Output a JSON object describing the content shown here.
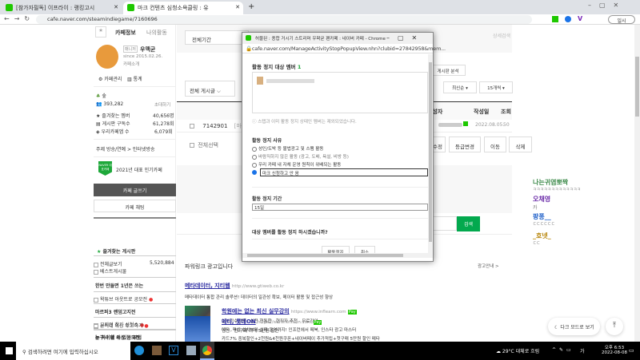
{
  "browser": {
    "tabs": [
      {
        "label": "[참가자필독] 이프라이 : 랭킹고시"
      },
      {
        "label": "마크 컨텐츠 심청소욕클링 : 유"
      }
    ],
    "url": "cafe.naver.com/steamindiegame/7160696",
    "profile_label": "일시"
  },
  "sidebar": {
    "tab_info": "카페정보",
    "tab_activity": "나의활동",
    "manager_badge": "매니저",
    "manager_name": "우맥균",
    "since": "since 2015.02.26.",
    "intro": "카페소개",
    "manage": "카페관리",
    "stats": "통계",
    "level": "숲",
    "members": "393,282",
    "invite": "초대하기",
    "stats_rows": [
      {
        "label": "즐겨찾는 멤버",
        "value": "40,656명"
      },
      {
        "label": "게시판 구독수",
        "value": "61,278회"
      },
      {
        "label": "우리카페앱 수",
        "value": "6,079회"
      }
    ],
    "topic": "주제 방송/연예 > 인터넷방송",
    "award_badge": "NAVER 대표카페",
    "award": "2021년 대표 인기카페",
    "write_btn": "카페 글쓰기",
    "chat_btn": "카페 채팅",
    "fav_header": "즐겨찾는 게시판",
    "boards": [
      {
        "type": "item",
        "label": "전체글보기",
        "count": "5,520,884"
      },
      {
        "type": "item",
        "label": "베스트게시물"
      },
      {
        "type": "header",
        "label": "한번 만들면 1년은 쓰는"
      },
      {
        "type": "item",
        "label": "왁튜브 아웃트로 공모전",
        "new": true
      },
      {
        "type": "header",
        "label": "마르퍼3 랜덤고지전"
      },
      {
        "type": "item",
        "label": "고지전 참가 신청소",
        "new": true
      },
      {
        "type": "header",
        "label": "늗 하이네 의상 공모전"
      },
      {
        "type": "item",
        "label": "늗이네 의상 투고하기",
        "new": true
      },
      {
        "type": "header",
        "label": "누구나 할 수 있는 부업"
      }
    ]
  },
  "main": {
    "period": "전체기간",
    "search_btn": "검색",
    "detail_search": "상세검색",
    "board_filter": "전체 게시글",
    "analysis_btn": "게시판 분석",
    "sort": "최신순",
    "per_page": "15개씩",
    "columns": [
      "작성자",
      "작성일",
      "조회"
    ],
    "row": {
      "id": "7142901",
      "prefix": "[마",
      "date": "2022.08.05.",
      "views": "50"
    },
    "select_all": "전체선택",
    "actions": [
      "머리 수정",
      "등급변경",
      "이동",
      "삭제"
    ],
    "search_btn2": "검색",
    "ad_header": "파워링크 광고입니다",
    "ad_info": "광고안내 >",
    "ads": [
      {
        "title": "메타데이터, 지티웹",
        "url": "http://www.gtiweb.co.kr",
        "desc": "메타데이터 통합 관리 솔루션! 데이터의 일관성 확보, 메이터 활용 및 접근성 향상"
      },
      {
        "title": "학원에는 없는 최신 실무강의",
        "url": "https://www.inflearn.com",
        "pay": "Pay",
        "sub": "실시간수강평 · 실전 현통합 · 현직자 추천 · 무료강의",
        "desc": "메타, 픽셀 설치부터 실제 운영까지! 인프런에서 페북, 인스타 광고 마스터"
      },
      {
        "title": "메타, 롯데ON",
        "url": "https://www.lotteon.com",
        "pay": "Pay",
        "sub": "멤인 · 전 구매 최대 5만원 할인",
        "desc": "카드7% 중복할인+2천원&4천원쿠폰+네이버페이 추가적립+첫구매 5만원 할인 메타"
      }
    ]
  },
  "popup": {
    "title": "허물된 : 종합 거시기 스트리머 우왁굳 팬카페 : 네이버 카페 - Chrome",
    "url": "cafe.naver.com/ManageActivityStopPopupView.nhn?clubid=27842958&mem...",
    "target_label": "활동 정지 대상 멤버",
    "target_count": "1",
    "notice": "스탭과 이미 활동 정지 상태인 멤버는 제외되었습니다.",
    "reason_label": "활동 정지 사유",
    "reasons": [
      "성인/도박 등 불법광고 및 스팸 활동",
      "바람직하지 않은 활동 (광고, 도배, 욕설, 비방 등)",
      "우리 카페 내 자체 운영 원칙이 위배되는 활동"
    ],
    "custom_reason": "마크 신청하고 안 옴",
    "period_label": "활동 정지 기간",
    "period_value": "15일",
    "confirm_q": "대상 멤버를 활동 정지 하시겠습니까?",
    "ok": "활동정지",
    "cancel": "취소"
  },
  "chat": [
    {
      "name": "나는귀염뽀짝",
      "msg": "ㅋㅋㅋㅋㅋㅋㅋㅋㅋㅋㅋㅋㅋ",
      "color": "#3d8a4a"
    },
    {
      "name": "오채영",
      "msg": "카",
      "color": "#6a2aa8"
    },
    {
      "name": "팡퐁__",
      "msg": "ㄷㄷㄷㄷㄷㄷ",
      "color": "#1e5fc8"
    },
    {
      "name": "_호넷_",
      "msg": "ㄷㄷ",
      "color": "#b8860b"
    }
  ],
  "dark_mode": "다크 모드로 보기",
  "taskbar": {
    "search": "검색하려면 여기에 입력하십시오",
    "weather": "29°C 대체로 흐림",
    "ime": "가",
    "time": "오후 6:53",
    "date": "2022-08-08"
  }
}
